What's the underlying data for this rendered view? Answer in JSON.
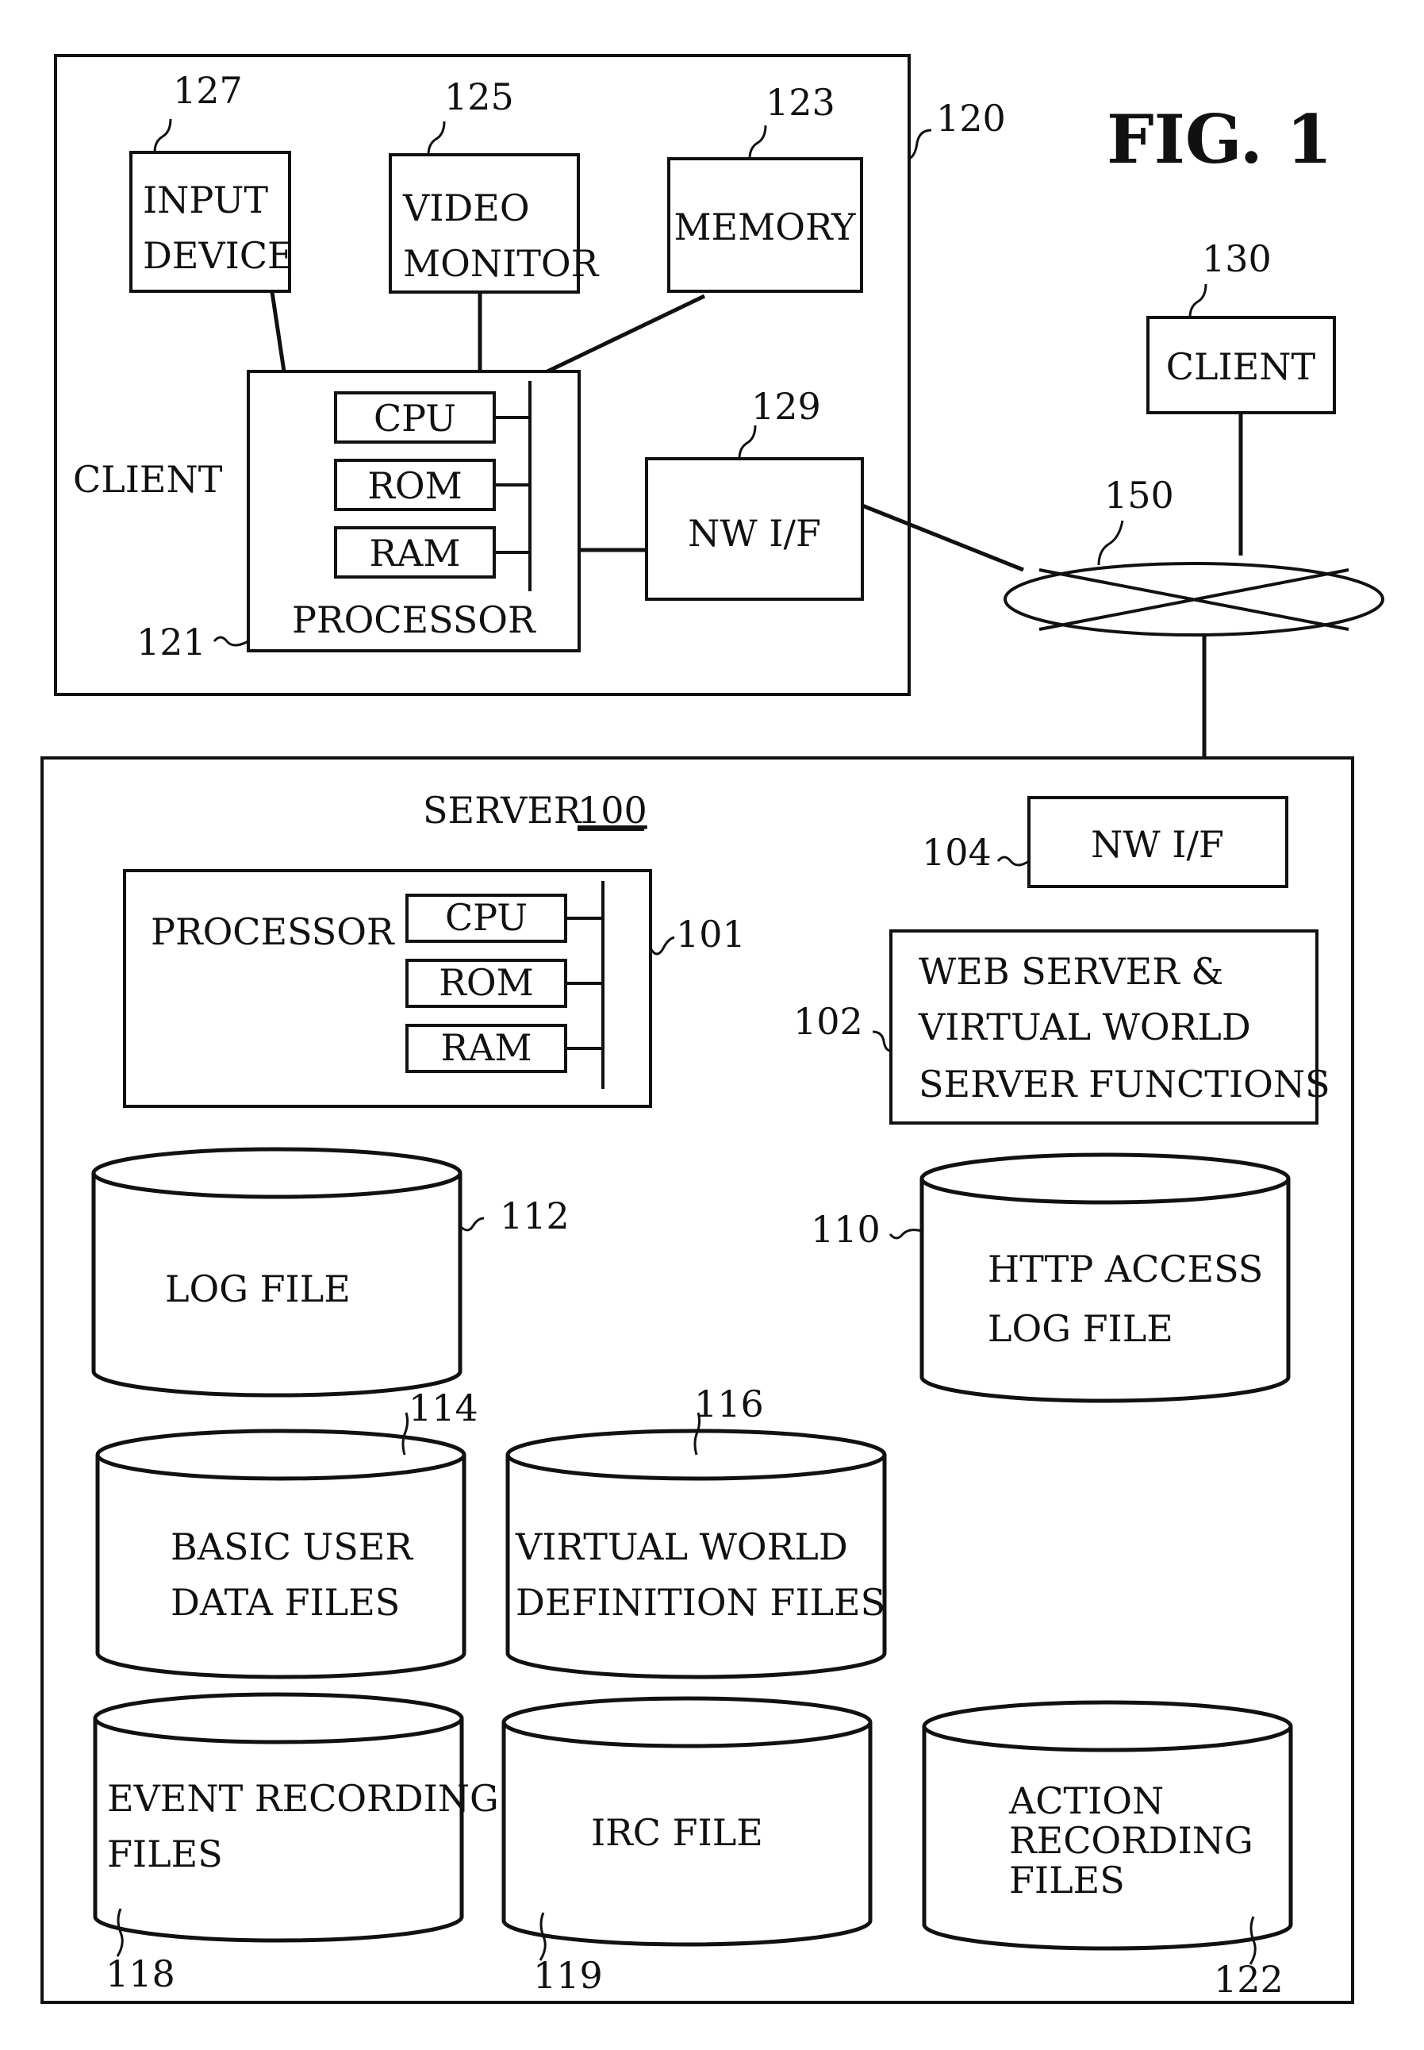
{
  "figure_title": "FIG. 1",
  "client_main": {
    "ref": "120",
    "label": "CLIENT",
    "input_device": {
      "ref": "127",
      "line1": "INPUT",
      "line2": "DEVICE"
    },
    "video_monitor": {
      "ref": "125",
      "line1": "VIDEO",
      "line2": "MONITOR"
    },
    "memory": {
      "ref": "123",
      "label": "MEMORY"
    },
    "processor": {
      "ref": "121",
      "label": "PROCESSOR",
      "cpu": "CPU",
      "rom": "ROM",
      "ram": "RAM"
    },
    "nw_if": {
      "ref": "129",
      "label": "NW I/F"
    }
  },
  "client_other": {
    "ref": "130",
    "label": "CLIENT"
  },
  "network": {
    "ref": "150"
  },
  "server": {
    "label": "SERVER",
    "ref": "100",
    "nw_if": {
      "ref": "104",
      "label": "NW I/F"
    },
    "processor": {
      "ref": "101",
      "label": "PROCESSOR",
      "cpu": "CPU",
      "rom": "ROM",
      "ram": "RAM"
    },
    "functions": {
      "ref": "102",
      "line1": "WEB SERVER &",
      "line2": "VIRTUAL WORLD",
      "line3": "SERVER FUNCTIONS"
    },
    "storages": [
      {
        "ref": "112",
        "lines": [
          "LOG FILE"
        ]
      },
      {
        "ref": "110",
        "lines": [
          "HTTP ACCESS",
          "LOG FILE"
        ]
      },
      {
        "ref": "114",
        "lines": [
          "BASIC USER",
          "DATA FILES"
        ]
      },
      {
        "ref": "116",
        "lines": [
          "VIRTUAL WORLD",
          "DEFINITION FILES"
        ]
      },
      {
        "ref": "118",
        "lines": [
          "EVENT RECORDING",
          "FILES"
        ]
      },
      {
        "ref": "119",
        "lines": [
          "IRC FILE"
        ]
      },
      {
        "ref": "122",
        "lines": [
          "ACTION",
          "RECORDING",
          "FILES"
        ]
      }
    ]
  }
}
